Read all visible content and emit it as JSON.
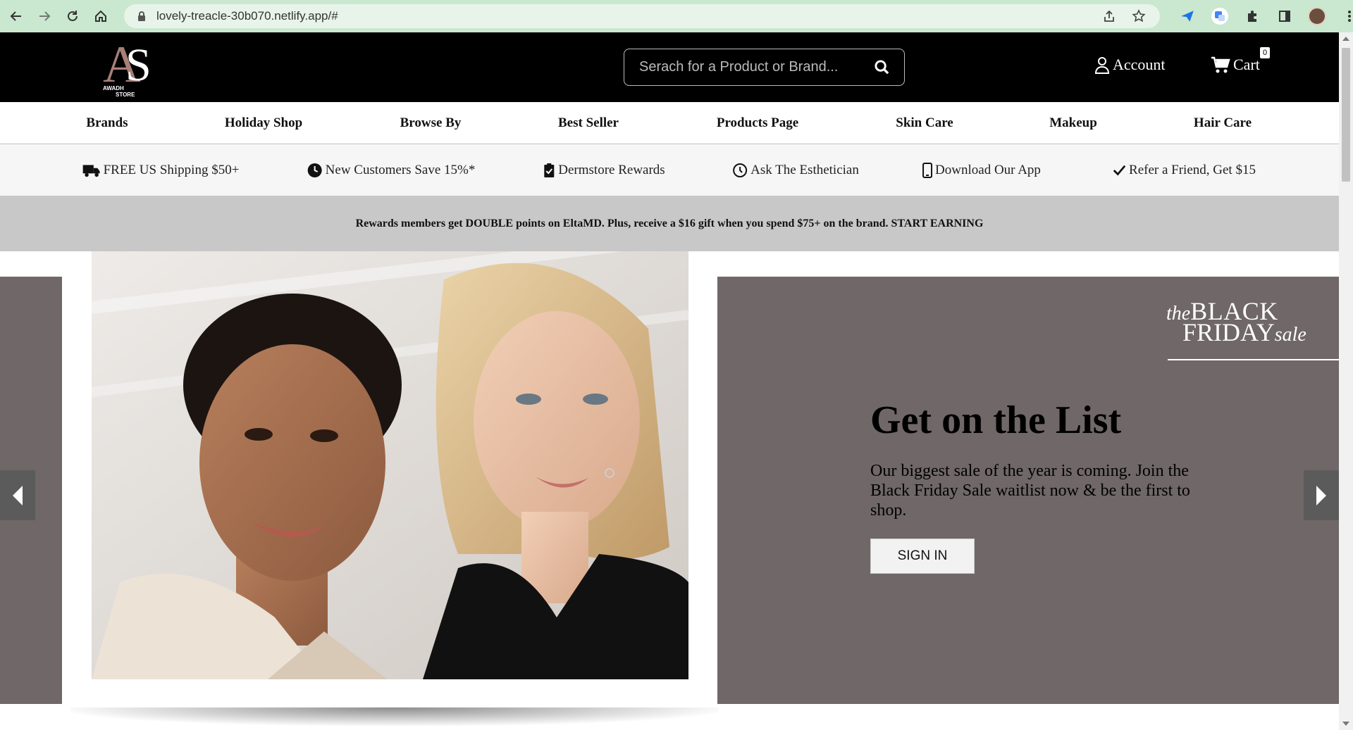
{
  "browser": {
    "url": "lovely-treacle-30b070.netlify.app/#",
    "back_icon": "arrow-left-icon",
    "forward_icon": "arrow-right-icon",
    "reload_icon": "reload-icon",
    "home_icon": "home-icon"
  },
  "header": {
    "logo_letters": "AS",
    "logo_text": "AWADH STORE",
    "search_placeholder": "Serach for a Product or Brand...",
    "account_label": "Account",
    "cart_label": "Cart",
    "cart_count": "0"
  },
  "nav": {
    "items": [
      "Brands",
      "Holiday Shop",
      "Browse By",
      "Best Seller",
      "Products Page",
      "Skin Care",
      "Makeup",
      "Hair Care"
    ]
  },
  "perks": {
    "items": [
      {
        "label": "FREE US Shipping $50+",
        "icon": "truck-icon"
      },
      {
        "label": "New Customers Save 15%*",
        "icon": "clock-icon"
      },
      {
        "label": "Dermstore Rewards",
        "icon": "clipboard-icon"
      },
      {
        "label": "Ask The Esthetician",
        "icon": "clock-outline-icon"
      },
      {
        "label": "Download Our App",
        "icon": "phone-icon"
      },
      {
        "label": "Refer a Friend, Get $15",
        "icon": "check-icon"
      }
    ]
  },
  "promo": {
    "text": "Rewards members get DOUBLE points on EltaMD. Plus, receive a $16 gift when you spend $75+ on the brand. START EARNING"
  },
  "hero": {
    "bf_the": "the",
    "bf_black": "BLACK",
    "bf_friday": "FRIDAY",
    "bf_sale": "sale",
    "title": "Get on the List",
    "text": "Our biggest sale of the year is coming. Join the Black Friday Sale waitlist now & be the first to shop.",
    "button_label": "SIGN IN"
  },
  "colors": {
    "header_bg": "#000000",
    "chrome_bg": "#c9e8cf",
    "hero_panel": "#6f6768",
    "promo_bg": "#c8c8c8",
    "logo_accent": "#a77f78"
  }
}
